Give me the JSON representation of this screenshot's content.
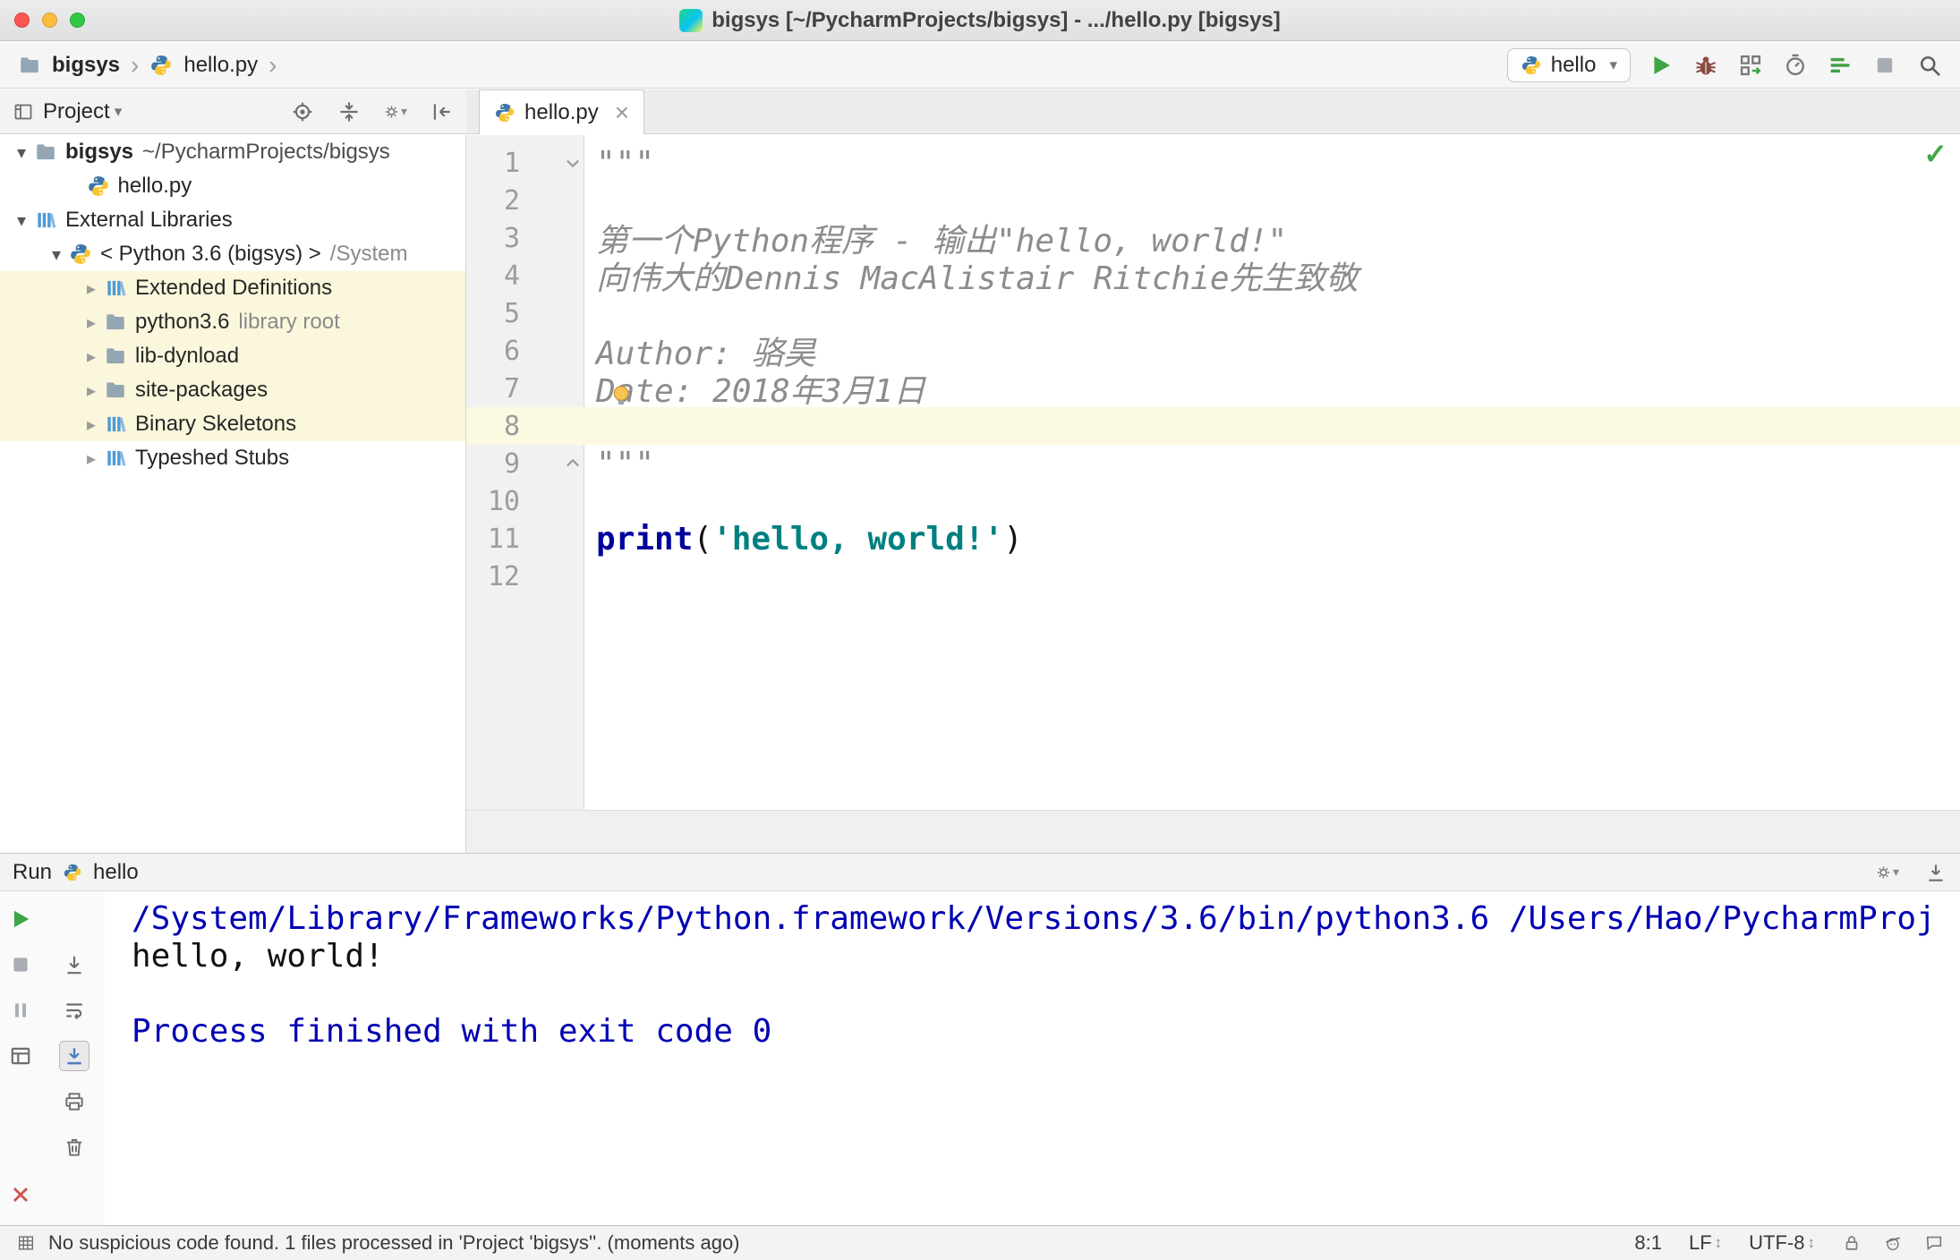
{
  "titlebar": {
    "title": "bigsys [~/PycharmProjects/bigsys] - .../hello.py [bigsys]"
  },
  "navbar": {
    "breadcrumb": {
      "project": "bigsys",
      "file": "hello.py"
    },
    "run_config": "hello",
    "buttons": [
      {
        "name": "run",
        "icon": "play"
      },
      {
        "name": "debug",
        "icon": "bug"
      },
      {
        "name": "run-with-coverage",
        "icon": "coverage"
      },
      {
        "name": "profile",
        "icon": "profiler"
      },
      {
        "name": "concurrency-diagram",
        "icon": "concurrency"
      },
      {
        "name": "stop",
        "icon": "stop"
      },
      {
        "name": "search-everywhere",
        "icon": "search"
      }
    ]
  },
  "project_panel": {
    "title": "Project",
    "buttons": [
      {
        "name": "scroll-from-source",
        "icon": "locate"
      },
      {
        "name": "expand-collapse",
        "icon": "collapse"
      },
      {
        "name": "settings",
        "icon": "gear",
        "dropdown": true
      },
      {
        "name": "hide-panel",
        "icon": "hide"
      }
    ],
    "tree": [
      {
        "label": "bigsys",
        "suffix": "~/PycharmProjects/bigsys",
        "icon": "folder",
        "expander": "down",
        "indent": 0,
        "bold": true,
        "suffixStrong": true
      },
      {
        "label": "hello.py",
        "icon": "python",
        "indent": 1.5
      },
      {
        "label": "External Libraries",
        "icon": "libs",
        "expander": "down",
        "indent": 0
      },
      {
        "label": "< Python 3.6 (bigsys) >",
        "suffix": "/System",
        "icon": "python",
        "expander": "down",
        "indent": 1
      },
      {
        "label": "Extended Definitions",
        "icon": "libs",
        "expander": "right",
        "indent": 2,
        "highlight": true
      },
      {
        "label": "python3.6",
        "suffix": "library root",
        "icon": "folder",
        "expander": "right",
        "indent": 2,
        "highlight": true
      },
      {
        "label": "lib-dynload",
        "icon": "folder",
        "expander": "right",
        "indent": 2,
        "highlight": true
      },
      {
        "label": "site-packages",
        "icon": "folder",
        "expander": "right",
        "indent": 2,
        "highlight": true
      },
      {
        "label": "Binary Skeletons",
        "icon": "libs",
        "expander": "right",
        "indent": 2,
        "highlight": true
      },
      {
        "label": "Typeshed Stubs",
        "icon": "libs",
        "expander": "right",
        "indent": 2
      }
    ]
  },
  "editor": {
    "tab": "hello.py",
    "lines": [
      {
        "num": "1",
        "fold": "down",
        "segs": [
          {
            "t": "\"\"\"",
            "c": "doc"
          }
        ]
      },
      {
        "num": "2",
        "segs": []
      },
      {
        "num": "3",
        "segs": [
          {
            "t": "第一个Python程序 - 输出\"hello, world!\"",
            "c": "doc"
          }
        ]
      },
      {
        "num": "4",
        "segs": [
          {
            "t": "向伟大的Dennis MacAlistair Ritchie先生致敬",
            "c": "doc"
          }
        ]
      },
      {
        "num": "5",
        "segs": []
      },
      {
        "num": "6",
        "segs": [
          {
            "t": "Author: 骆昊",
            "c": "doc"
          }
        ]
      },
      {
        "num": "7",
        "segs": [
          {
            "t": "Date: 2018年3月1日",
            "c": "doc"
          }
        ]
      },
      {
        "num": "8",
        "current": true,
        "segs": []
      },
      {
        "num": "9",
        "fold": "up",
        "segs": [
          {
            "t": "\"\"\"",
            "c": "doc"
          }
        ]
      },
      {
        "num": "10",
        "segs": []
      },
      {
        "num": "11",
        "segs": [
          {
            "t": "print",
            "c": "kw"
          },
          {
            "t": "(",
            "c": "plain"
          },
          {
            "t": "'hello, world!'",
            "c": "str"
          },
          {
            "t": ")",
            "c": "plain"
          }
        ]
      },
      {
        "num": "12",
        "segs": []
      }
    ]
  },
  "run_panel": {
    "title": "Run",
    "config": "hello",
    "header_buttons": [
      {
        "name": "console-settings",
        "icon": "gear",
        "dropdown": true
      },
      {
        "name": "hide-run-panel",
        "icon": "hidebar"
      }
    ],
    "toolbar_main": [
      {
        "name": "rerun",
        "icon": "play"
      },
      {
        "name": "stop",
        "icon": "stop"
      },
      {
        "name": "pause-output",
        "icon": "pause"
      },
      {
        "name": "restore-layout",
        "icon": "layout"
      },
      {
        "name": "close",
        "icon": "close",
        "gap": true
      },
      {
        "name": "more-options",
        "icon": "more"
      }
    ],
    "toolbar_console": [
      {
        "name": "jump-to-end",
        "icon": "arrowdown"
      },
      {
        "name": "use-soft-wraps",
        "icon": "wrap"
      },
      {
        "name": "scroll-to-end",
        "icon": "scrollend",
        "pressed": true
      },
      {
        "name": "print",
        "icon": "print"
      },
      {
        "name": "clear-all",
        "icon": "trash"
      }
    ],
    "console": [
      {
        "text": "/System/Library/Frameworks/Python.framework/Versions/3.6/bin/python3.6 /Users/Hao/PycharmProj",
        "c": "sys"
      },
      {
        "text": "hello, world!",
        "c": "out"
      },
      {
        "text": "",
        "c": "out"
      },
      {
        "text": "Process finished with exit code 0",
        "c": "sys"
      }
    ]
  },
  "statusbar": {
    "message": "No suspicious code found. 1 files processed in 'Project 'bigsys''. (moments ago)",
    "position": "8:1",
    "line_separator": "LF",
    "encoding": "UTF-8",
    "icons": [
      {
        "name": "readonly-lock",
        "icon": "lock"
      },
      {
        "name": "hector-inspector",
        "icon": "hector"
      },
      {
        "name": "event-log",
        "icon": "bubble"
      }
    ]
  },
  "glyphs": {
    "separator": "›",
    "dropdown": "▾",
    "expand_down": "▾",
    "expand_right": "▸",
    "more": "»",
    "check": "✓",
    "updown": "↕",
    "close_tab": "×"
  },
  "colors": {
    "console_system": "#0000B3",
    "console_output": "#111111",
    "string": "#008080",
    "keyword": "#00009C",
    "docstring": "#8C8C8C",
    "tree_highlight": "#FBF7DC",
    "current_line": "#FCF9E2",
    "run_green": "#3FA546"
  }
}
